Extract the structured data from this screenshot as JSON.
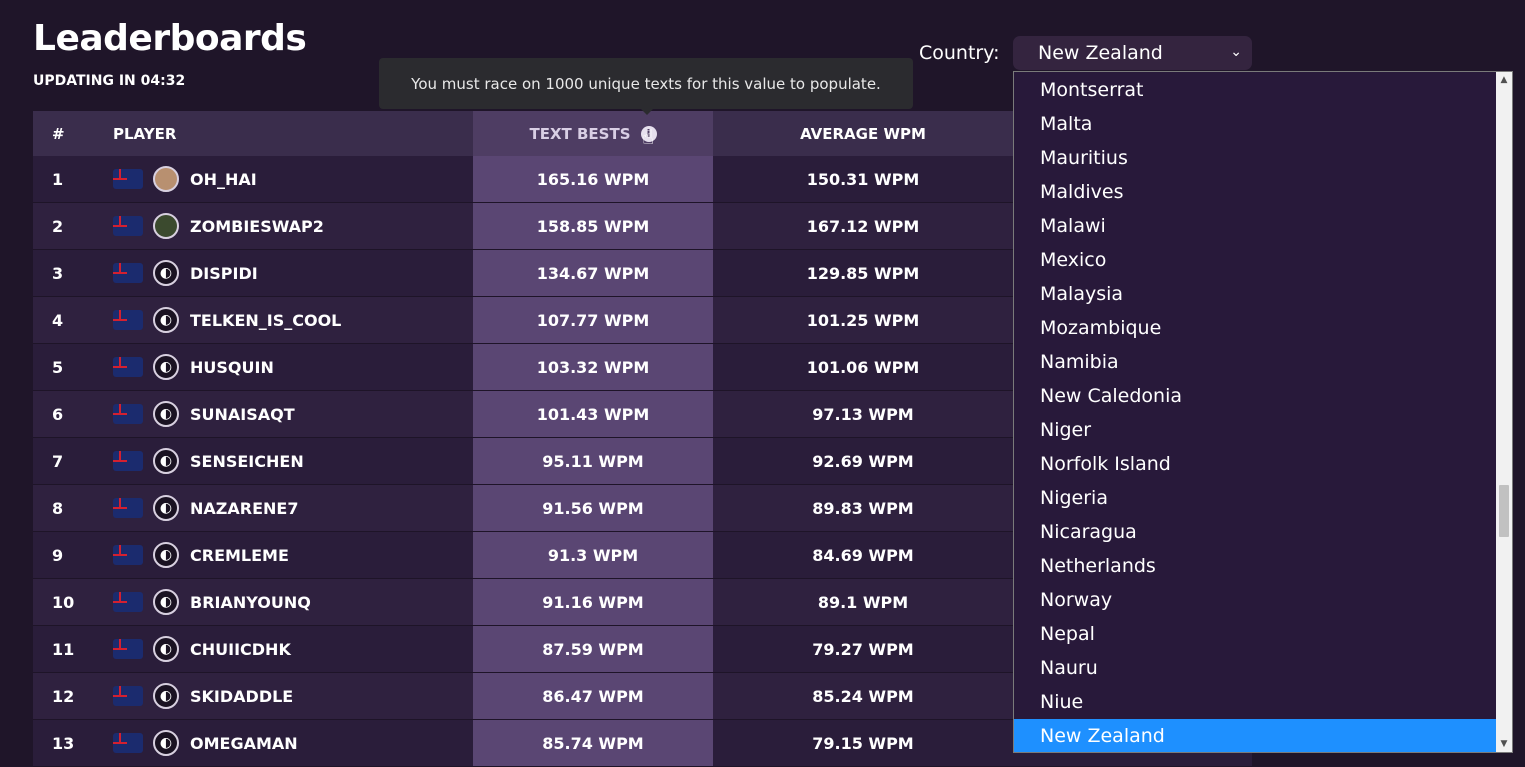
{
  "header": {
    "title": "Leaderboards",
    "updating": "UPDATING IN 04:32"
  },
  "tooltip": "You must race on 1000 unique texts for this value to populate.",
  "country": {
    "label": "Country:",
    "selected": "New Zealand",
    "options": [
      "Montserrat",
      "Malta",
      "Mauritius",
      "Maldives",
      "Malawi",
      "Mexico",
      "Malaysia",
      "Mozambique",
      "Namibia",
      "New Caledonia",
      "Niger",
      "Norfolk Island",
      "Nigeria",
      "Nicaragua",
      "Netherlands",
      "Norway",
      "Nepal",
      "Nauru",
      "Niue",
      "New Zealand"
    ]
  },
  "table": {
    "columns": [
      "#",
      "PLAYER",
      "TEXT BESTS",
      "AVERAGE WPM"
    ],
    "rows": [
      {
        "rank": "1",
        "player": "OH_HAI",
        "text_bests": "165.16 WPM",
        "avg_wpm": "150.31 WPM"
      },
      {
        "rank": "2",
        "player": "ZOMBIESWAP2",
        "text_bests": "158.85 WPM",
        "avg_wpm": "167.12 WPM"
      },
      {
        "rank": "3",
        "player": "DISPIDI",
        "text_bests": "134.67 WPM",
        "avg_wpm": "129.85 WPM"
      },
      {
        "rank": "4",
        "player": "TELKEN_IS_COOL",
        "text_bests": "107.77 WPM",
        "avg_wpm": "101.25 WPM"
      },
      {
        "rank": "5",
        "player": "HUSQUIN",
        "text_bests": "103.32 WPM",
        "avg_wpm": "101.06 WPM"
      },
      {
        "rank": "6",
        "player": "SUNAISAQT",
        "text_bests": "101.43 WPM",
        "avg_wpm": "97.13 WPM"
      },
      {
        "rank": "7",
        "player": "SENSEICHEN",
        "text_bests": "95.11 WPM",
        "avg_wpm": "92.69 WPM"
      },
      {
        "rank": "8",
        "player": "NAZARENE7",
        "text_bests": "91.56 WPM",
        "avg_wpm": "89.83 WPM"
      },
      {
        "rank": "9",
        "player": "CREMLEME",
        "text_bests": "91.3 WPM",
        "avg_wpm": "84.69 WPM"
      },
      {
        "rank": "10",
        "player": "BRIANYOUNQ",
        "text_bests": "91.16 WPM",
        "avg_wpm": "89.1 WPM"
      },
      {
        "rank": "11",
        "player": "CHUIICDHK",
        "text_bests": "87.59 WPM",
        "avg_wpm": "79.27 WPM"
      },
      {
        "rank": "12",
        "player": "SKIDADDLE",
        "text_bests": "86.47 WPM",
        "avg_wpm": "85.24 WPM"
      },
      {
        "rank": "13",
        "player": "OMEGAMAN",
        "text_bests": "85.74 WPM",
        "avg_wpm": "79.15 WPM"
      }
    ]
  },
  "colors": {
    "background": "#1f1529",
    "text_bests_column": "#5a4673",
    "selected_option": "#1e90ff"
  }
}
